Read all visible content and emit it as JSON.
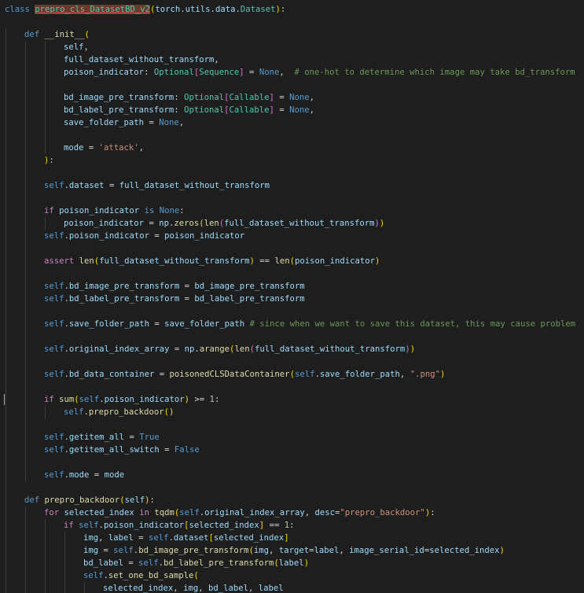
{
  "editor": {
    "language": "python",
    "cursor_line": 31,
    "colors": {
      "background": "#1e1e1e",
      "keyword": "#569cd6",
      "control": "#c586c0",
      "class": "#4ec9b0",
      "function": "#dcdcaa",
      "variable": "#9cdcfe",
      "string": "#ce9178",
      "number": "#b5cea8",
      "comment": "#6a9955",
      "bracket1": "#ffd700",
      "bracket2": "#da70d6",
      "bracket3": "#179fff",
      "highlight": "#6b3a2a"
    },
    "lines": [
      {
        "indent": 0,
        "tokens": [
          [
            "kw",
            "class "
          ],
          [
            "hl",
            "prepro_cls_DatasetBD_v2"
          ],
          [
            "br1",
            "("
          ],
          [
            "var",
            "torch"
          ],
          [
            "pl",
            "."
          ],
          [
            "var",
            "utils"
          ],
          [
            "pl",
            "."
          ],
          [
            "var",
            "data"
          ],
          [
            "pl",
            "."
          ],
          [
            "cls",
            "Dataset"
          ],
          [
            "br1",
            ")"
          ],
          [
            "pl",
            ":"
          ]
        ]
      },
      {
        "indent": 0,
        "tokens": []
      },
      {
        "indent": 1,
        "tokens": [
          [
            "kw",
            "def "
          ],
          [
            "fn",
            "__init__"
          ],
          [
            "br1",
            "("
          ]
        ]
      },
      {
        "indent": 3,
        "tokens": [
          [
            "var",
            "self"
          ],
          [
            "pl",
            ","
          ]
        ]
      },
      {
        "indent": 3,
        "tokens": [
          [
            "var",
            "full_dataset_without_transform"
          ],
          [
            "pl",
            ","
          ]
        ]
      },
      {
        "indent": 3,
        "tokens": [
          [
            "var",
            "poison_indicator"
          ],
          [
            "pl",
            ": "
          ],
          [
            "cls",
            "Optional"
          ],
          [
            "br2",
            "["
          ],
          [
            "cls",
            "Sequence"
          ],
          [
            "br2",
            "]"
          ],
          [
            "pl",
            " = "
          ],
          [
            "kw",
            "None"
          ],
          [
            "pl",
            ",  "
          ],
          [
            "com",
            "# one-hot to determine which image may take bd_transform"
          ]
        ]
      },
      {
        "indent": 0,
        "tokens": []
      },
      {
        "indent": 3,
        "tokens": [
          [
            "var",
            "bd_image_pre_transform"
          ],
          [
            "pl",
            ": "
          ],
          [
            "cls",
            "Optional"
          ],
          [
            "br2",
            "["
          ],
          [
            "cls",
            "Callable"
          ],
          [
            "br2",
            "]"
          ],
          [
            "pl",
            " = "
          ],
          [
            "kw",
            "None"
          ],
          [
            "pl",
            ","
          ]
        ]
      },
      {
        "indent": 3,
        "tokens": [
          [
            "var",
            "bd_label_pre_transform"
          ],
          [
            "pl",
            ": "
          ],
          [
            "cls",
            "Optional"
          ],
          [
            "br2",
            "["
          ],
          [
            "cls",
            "Callable"
          ],
          [
            "br2",
            "]"
          ],
          [
            "pl",
            " = "
          ],
          [
            "kw",
            "None"
          ],
          [
            "pl",
            ","
          ]
        ]
      },
      {
        "indent": 3,
        "tokens": [
          [
            "var",
            "save_folder_path"
          ],
          [
            "pl",
            " = "
          ],
          [
            "kw",
            "None"
          ],
          [
            "pl",
            ","
          ]
        ]
      },
      {
        "indent": 0,
        "tokens": []
      },
      {
        "indent": 3,
        "tokens": [
          [
            "var",
            "mode"
          ],
          [
            "pl",
            " = "
          ],
          [
            "str",
            "'attack'"
          ],
          [
            "pl",
            ","
          ]
        ]
      },
      {
        "indent": 2,
        "tokens": [
          [
            "br1",
            ")"
          ],
          [
            "pl",
            ":"
          ]
        ]
      },
      {
        "indent": 0,
        "tokens": []
      },
      {
        "indent": 2,
        "tokens": [
          [
            "kw",
            "self"
          ],
          [
            "pl",
            "."
          ],
          [
            "var",
            "dataset"
          ],
          [
            "pl",
            " = "
          ],
          [
            "var",
            "full_dataset_without_transform"
          ]
        ]
      },
      {
        "indent": 0,
        "tokens": []
      },
      {
        "indent": 2,
        "tokens": [
          [
            "ctrl",
            "if "
          ],
          [
            "var",
            "poison_indicator"
          ],
          [
            "kw",
            " is "
          ],
          [
            "kw",
            "None"
          ],
          [
            "pl",
            ":"
          ]
        ]
      },
      {
        "indent": 3,
        "tokens": [
          [
            "var",
            "poison_indicator"
          ],
          [
            "pl",
            " = "
          ],
          [
            "var",
            "np"
          ],
          [
            "pl",
            "."
          ],
          [
            "fn",
            "zeros"
          ],
          [
            "br1",
            "("
          ],
          [
            "fn",
            "len"
          ],
          [
            "br2",
            "("
          ],
          [
            "var",
            "full_dataset_without_transform"
          ],
          [
            "br2",
            ")"
          ],
          [
            "br1",
            ")"
          ]
        ]
      },
      {
        "indent": 2,
        "tokens": [
          [
            "kw",
            "self"
          ],
          [
            "pl",
            "."
          ],
          [
            "var",
            "poison_indicator"
          ],
          [
            "pl",
            " = "
          ],
          [
            "var",
            "poison_indicator"
          ]
        ]
      },
      {
        "indent": 0,
        "tokens": []
      },
      {
        "indent": 2,
        "tokens": [
          [
            "ctrl",
            "assert "
          ],
          [
            "fn",
            "len"
          ],
          [
            "br1",
            "("
          ],
          [
            "var",
            "full_dataset_without_transform"
          ],
          [
            "br1",
            ")"
          ],
          [
            "pl",
            " == "
          ],
          [
            "fn",
            "len"
          ],
          [
            "br1",
            "("
          ],
          [
            "var",
            "poison_indicator"
          ],
          [
            "br1",
            ")"
          ]
        ]
      },
      {
        "indent": 0,
        "tokens": []
      },
      {
        "indent": 2,
        "tokens": [
          [
            "kw",
            "self"
          ],
          [
            "pl",
            "."
          ],
          [
            "var",
            "bd_image_pre_transform"
          ],
          [
            "pl",
            " = "
          ],
          [
            "var",
            "bd_image_pre_transform"
          ]
        ]
      },
      {
        "indent": 2,
        "tokens": [
          [
            "kw",
            "self"
          ],
          [
            "pl",
            "."
          ],
          [
            "var",
            "bd_label_pre_transform"
          ],
          [
            "pl",
            " = "
          ],
          [
            "var",
            "bd_label_pre_transform"
          ]
        ]
      },
      {
        "indent": 0,
        "tokens": []
      },
      {
        "indent": 2,
        "tokens": [
          [
            "kw",
            "self"
          ],
          [
            "pl",
            "."
          ],
          [
            "var",
            "save_folder_path"
          ],
          [
            "pl",
            " = "
          ],
          [
            "var",
            "save_folder_path"
          ],
          [
            "com",
            " # since when we want to save this dataset, this may cause problem"
          ]
        ]
      },
      {
        "indent": 0,
        "tokens": []
      },
      {
        "indent": 2,
        "tokens": [
          [
            "kw",
            "self"
          ],
          [
            "pl",
            "."
          ],
          [
            "var",
            "original_index_array"
          ],
          [
            "pl",
            " = "
          ],
          [
            "var",
            "np"
          ],
          [
            "pl",
            "."
          ],
          [
            "fn",
            "arange"
          ],
          [
            "br1",
            "("
          ],
          [
            "fn",
            "len"
          ],
          [
            "br2",
            "("
          ],
          [
            "var",
            "full_dataset_without_transform"
          ],
          [
            "br2",
            ")"
          ],
          [
            "br1",
            ")"
          ]
        ]
      },
      {
        "indent": 0,
        "tokens": []
      },
      {
        "indent": 2,
        "tokens": [
          [
            "kw",
            "self"
          ],
          [
            "pl",
            "."
          ],
          [
            "var",
            "bd_data_container"
          ],
          [
            "pl",
            " = "
          ],
          [
            "fn",
            "poisonedCLSDataContainer"
          ],
          [
            "br1",
            "("
          ],
          [
            "kw",
            "self"
          ],
          [
            "pl",
            "."
          ],
          [
            "var",
            "save_folder_path"
          ],
          [
            "pl",
            ", "
          ],
          [
            "str",
            "\".png\""
          ],
          [
            "br1",
            ")"
          ]
        ]
      },
      {
        "indent": 0,
        "tokens": []
      },
      {
        "indent": 2,
        "tokens": [
          [
            "ctrl",
            "if "
          ],
          [
            "fn",
            "sum"
          ],
          [
            "br1",
            "("
          ],
          [
            "kw",
            "self"
          ],
          [
            "pl",
            "."
          ],
          [
            "var",
            "poison_indicator"
          ],
          [
            "br1",
            ")"
          ],
          [
            "pl",
            " >= "
          ],
          [
            "num",
            "1"
          ],
          [
            "pl",
            ":"
          ]
        ]
      },
      {
        "indent": 3,
        "tokens": [
          [
            "kw",
            "self"
          ],
          [
            "pl",
            "."
          ],
          [
            "fn",
            "prepro_backdoor"
          ],
          [
            "br1",
            "()"
          ]
        ]
      },
      {
        "indent": 0,
        "tokens": []
      },
      {
        "indent": 2,
        "tokens": [
          [
            "kw",
            "self"
          ],
          [
            "pl",
            "."
          ],
          [
            "var",
            "getitem_all"
          ],
          [
            "pl",
            " = "
          ],
          [
            "kw",
            "True"
          ]
        ]
      },
      {
        "indent": 2,
        "tokens": [
          [
            "kw",
            "self"
          ],
          [
            "pl",
            "."
          ],
          [
            "var",
            "getitem_all_switch"
          ],
          [
            "pl",
            " = "
          ],
          [
            "kw",
            "False"
          ]
        ]
      },
      {
        "indent": 0,
        "tokens": []
      },
      {
        "indent": 2,
        "tokens": [
          [
            "kw",
            "self"
          ],
          [
            "pl",
            "."
          ],
          [
            "var",
            "mode"
          ],
          [
            "pl",
            " = "
          ],
          [
            "var",
            "mode"
          ]
        ]
      },
      {
        "indent": 0,
        "tokens": []
      },
      {
        "indent": 1,
        "tokens": [
          [
            "kw",
            "def "
          ],
          [
            "fn",
            "prepro_backdoor"
          ],
          [
            "br1",
            "("
          ],
          [
            "var",
            "self"
          ],
          [
            "br1",
            ")"
          ],
          [
            "pl",
            ":"
          ]
        ]
      },
      {
        "indent": 2,
        "tokens": [
          [
            "ctrl",
            "for "
          ],
          [
            "var",
            "selected_index"
          ],
          [
            "ctrl",
            " in "
          ],
          [
            "fn",
            "tqdm"
          ],
          [
            "br1",
            "("
          ],
          [
            "kw",
            "self"
          ],
          [
            "pl",
            "."
          ],
          [
            "var",
            "original_index_array"
          ],
          [
            "pl",
            ", "
          ],
          [
            "var",
            "desc"
          ],
          [
            "pl",
            "="
          ],
          [
            "str",
            "\"prepro_backdoor\""
          ],
          [
            "br1",
            ")"
          ],
          [
            "pl",
            ":"
          ]
        ]
      },
      {
        "indent": 3,
        "tokens": [
          [
            "ctrl",
            "if "
          ],
          [
            "kw",
            "self"
          ],
          [
            "pl",
            "."
          ],
          [
            "var",
            "poison_indicator"
          ],
          [
            "br1",
            "["
          ],
          [
            "var",
            "selected_index"
          ],
          [
            "br1",
            "]"
          ],
          [
            "pl",
            " == "
          ],
          [
            "num",
            "1"
          ],
          [
            "pl",
            ":"
          ]
        ]
      },
      {
        "indent": 4,
        "tokens": [
          [
            "var",
            "img"
          ],
          [
            "pl",
            ", "
          ],
          [
            "var",
            "label"
          ],
          [
            "pl",
            " = "
          ],
          [
            "kw",
            "self"
          ],
          [
            "pl",
            "."
          ],
          [
            "var",
            "dataset"
          ],
          [
            "br1",
            "["
          ],
          [
            "var",
            "selected_index"
          ],
          [
            "br1",
            "]"
          ]
        ]
      },
      {
        "indent": 4,
        "tokens": [
          [
            "var",
            "img"
          ],
          [
            "pl",
            " = "
          ],
          [
            "kw",
            "self"
          ],
          [
            "pl",
            "."
          ],
          [
            "fn",
            "bd_image_pre_transform"
          ],
          [
            "br1",
            "("
          ],
          [
            "var",
            "img"
          ],
          [
            "pl",
            ", "
          ],
          [
            "var",
            "target"
          ],
          [
            "pl",
            "="
          ],
          [
            "var",
            "label"
          ],
          [
            "pl",
            ", "
          ],
          [
            "var",
            "image_serial_id"
          ],
          [
            "pl",
            "="
          ],
          [
            "var",
            "selected_index"
          ],
          [
            "br1",
            ")"
          ]
        ]
      },
      {
        "indent": 4,
        "tokens": [
          [
            "var",
            "bd_label"
          ],
          [
            "pl",
            " = "
          ],
          [
            "kw",
            "self"
          ],
          [
            "pl",
            "."
          ],
          [
            "fn",
            "bd_label_pre_transform"
          ],
          [
            "br1",
            "("
          ],
          [
            "var",
            "label"
          ],
          [
            "br1",
            ")"
          ]
        ]
      },
      {
        "indent": 4,
        "tokens": [
          [
            "kw",
            "self"
          ],
          [
            "pl",
            "."
          ],
          [
            "fn",
            "set_one_bd_sample"
          ],
          [
            "br1",
            "("
          ]
        ]
      },
      {
        "indent": 5,
        "tokens": [
          [
            "var",
            "selected_index"
          ],
          [
            "pl",
            ", "
          ],
          [
            "var",
            "img"
          ],
          [
            "pl",
            ", "
          ],
          [
            "var",
            "bd_label"
          ],
          [
            "pl",
            ", "
          ],
          [
            "var",
            "label"
          ]
        ]
      }
    ]
  }
}
